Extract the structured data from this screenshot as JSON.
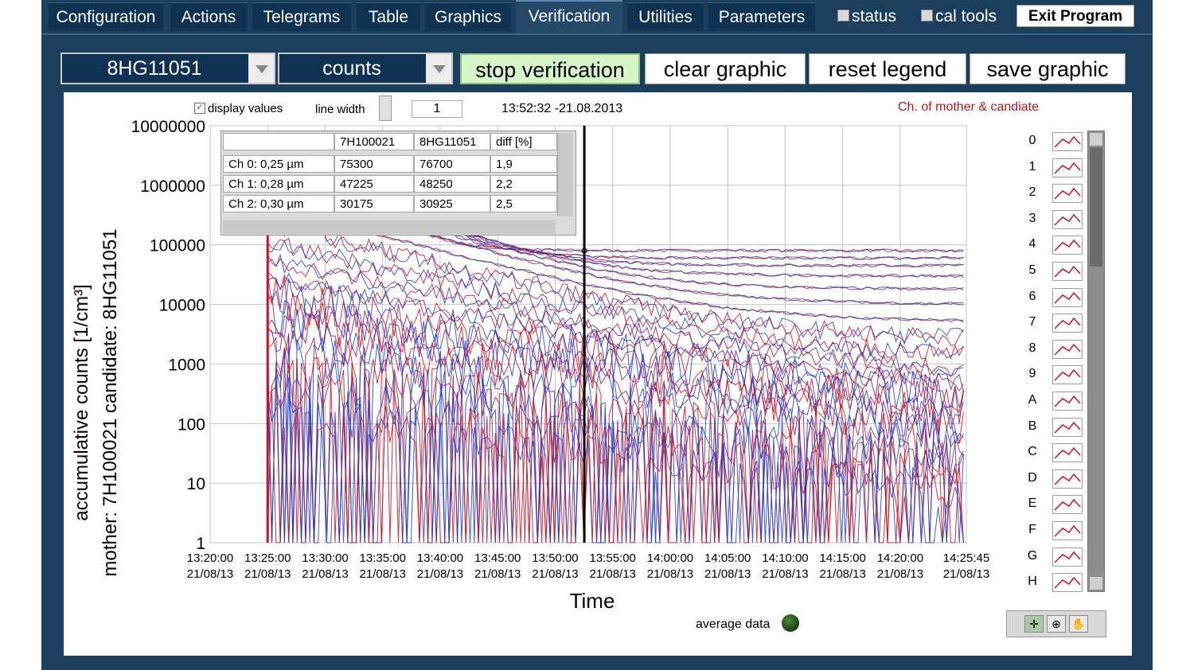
{
  "tabs": [
    {
      "label": "Configuration",
      "active": false
    },
    {
      "label": "Actions",
      "active": false
    },
    {
      "label": "Telegrams",
      "active": false
    },
    {
      "label": "Table",
      "active": false
    },
    {
      "label": "Graphics",
      "active": false
    },
    {
      "label": "Verification",
      "active": true
    },
    {
      "label": "Utilities",
      "active": false
    },
    {
      "label": "Parameters",
      "active": false
    }
  ],
  "top_checks": {
    "status": "status",
    "cal_tools": "cal tools"
  },
  "exit_label": "Exit Program",
  "toolbar": {
    "device_select": "8HG11051",
    "mode_select": "counts",
    "stop_verification": "stop verification",
    "clear_graphic": "clear graphic",
    "reset_legend": "reset legend",
    "save_graphic": "save graphic"
  },
  "controls": {
    "display_values": "display values",
    "line_width_label": "line width",
    "line_width_value": "1",
    "timestamp": "13:52:32 -21.08.2013",
    "legend_title": "Ch. of mother & candiate"
  },
  "table": {
    "headers": [
      "",
      "7H100021",
      "8HG11051",
      "diff [%]"
    ],
    "rows": [
      [
        "Ch 0: 0,25 µm",
        "75300",
        "76700",
        "1,9"
      ],
      [
        "Ch 1: 0,28 µm",
        "47225",
        "48250",
        "2,2"
      ],
      [
        "Ch 2: 0,30 µm",
        "30175",
        "30925",
        "2,5"
      ]
    ]
  },
  "legend_items": [
    "0",
    "1",
    "2",
    "3",
    "4",
    "5",
    "6",
    "7",
    "8",
    "9",
    "A",
    "B",
    "C",
    "D",
    "E",
    "F",
    "G",
    "H"
  ],
  "average_data_label": "average data",
  "colors": {
    "mother": "#cc1020",
    "candidate": "#1f3fd0",
    "cursor": "#000000"
  },
  "chart_data": {
    "type": "line",
    "ylabel_line1": "accumulative counts [1/cm³]",
    "ylabel_line2": "mother: 7H100021   candidate: 8HG11051",
    "xlabel": "Time",
    "y_scale": "log",
    "ylim": [
      1,
      10000000
    ],
    "y_ticks": [
      "1",
      "10",
      "100",
      "1000",
      "10000",
      "100000",
      "1000000",
      "10000000"
    ],
    "x_ticks": [
      [
        "13:20:00",
        "21/08/13"
      ],
      [
        "13:25:00",
        "21/08/13"
      ],
      [
        "13:30:00",
        "21/08/13"
      ],
      [
        "13:35:00",
        "21/08/13"
      ],
      [
        "13:40:00",
        "21/08/13"
      ],
      [
        "13:45:00",
        "21/08/13"
      ],
      [
        "13:50:00",
        "21/08/13"
      ],
      [
        "13:55:00",
        "21/08/13"
      ],
      [
        "14:00:00",
        "21/08/13"
      ],
      [
        "14:05:00",
        "21/08/13"
      ],
      [
        "14:10:00",
        "21/08/13"
      ],
      [
        "14:15:00",
        "21/08/13"
      ],
      [
        "14:20:00",
        "21/08/13"
      ],
      [
        "14:25:45",
        "21/08/13"
      ]
    ],
    "x_start": "13:20:00",
    "x_end": "14:25:45",
    "data_start": "13:25:00",
    "cursor_time": "13:52:32",
    "grid": true,
    "series_plateaus": [
      80000,
      60000,
      45000,
      30000,
      18000,
      10000,
      5000,
      2500,
      1200,
      600,
      300,
      150,
      80,
      40,
      20,
      10,
      5,
      2
    ]
  }
}
